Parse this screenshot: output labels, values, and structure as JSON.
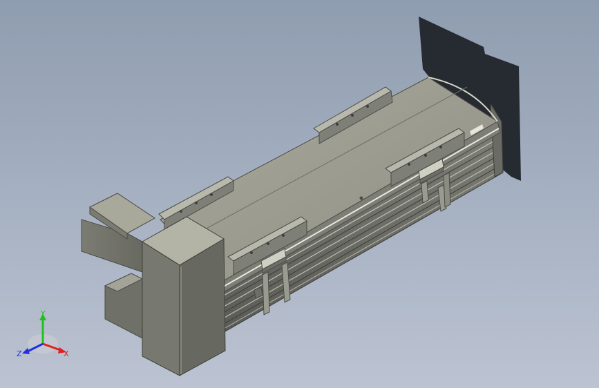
{
  "viewport": {
    "background_top": "#8f9db0",
    "background_bottom": "#bcc3d2"
  },
  "model": {
    "body_color": "#8c8c80",
    "top_color": "#a3a396",
    "dark_color": "#5c5d58",
    "shadow_color": "#262b31"
  },
  "triad": {
    "x_label": "X",
    "y_label": "Y",
    "z_label": "Z",
    "x_color": "#e02020",
    "y_color": "#20c020",
    "z_color": "#2030e0"
  }
}
